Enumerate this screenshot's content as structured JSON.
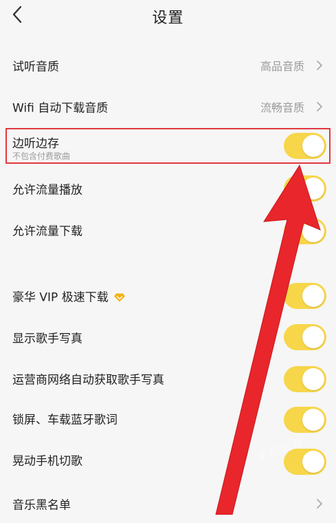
{
  "header": {
    "title": "设置",
    "back_icon": "chevron-left-icon"
  },
  "rows": {
    "preview_quality": {
      "label": "试听音质",
      "value": "高品音质"
    },
    "wifi_download_quality": {
      "label": "Wifi 自动下载音质",
      "value": "流畅音质"
    },
    "listen_while_save": {
      "label": "边听边存",
      "sublabel": "不包含付费歌曲",
      "on": true
    },
    "allow_data_play": {
      "label": "允许流量播放",
      "on": true
    },
    "allow_data_download": {
      "label": "允许流量下载",
      "on": true
    },
    "vip_fast_download": {
      "label": "豪华 VIP 极速下载",
      "on": true
    },
    "show_artist_photo": {
      "label": "显示歌手写真",
      "on": true
    },
    "carrier_auto_photo": {
      "label": "运营商网络自动获取歌手写真",
      "on": true
    },
    "lock_screen_lyrics": {
      "label": "锁屏、车载蓝牙歌词",
      "on": true
    },
    "shake_switch": {
      "label": "晃动手机切歌",
      "on": true
    },
    "music_blacklist": {
      "label": "音乐黑名单"
    }
  },
  "colors": {
    "toggle_on": "#f7d64a",
    "highlight": "#e0383e",
    "arrow": "#e8262b"
  },
  "watermark": "手机软件"
}
